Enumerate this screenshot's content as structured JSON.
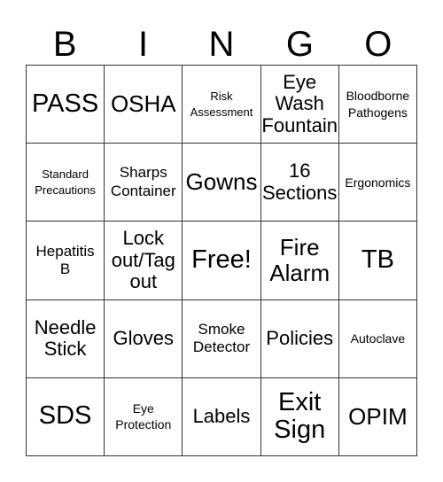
{
  "card": {
    "header": [
      "B",
      "I",
      "N",
      "G",
      "O"
    ],
    "rows": [
      [
        {
          "text": "PASS",
          "size": "s-xl"
        },
        {
          "text": "OSHA",
          "size": "s-l"
        },
        {
          "text": "Risk\nAssessment",
          "size": "s-xxs"
        },
        {
          "text": "Eye\nWash\nFountain",
          "size": "s-m"
        },
        {
          "text": "Bloodborne\nPathogens",
          "size": "s-xs"
        }
      ],
      [
        {
          "text": "Standard\nPrecautions",
          "size": "s-xxs"
        },
        {
          "text": "Sharps\nContainer",
          "size": "s-s"
        },
        {
          "text": "Gowns",
          "size": "s-l"
        },
        {
          "text": "16\nSections",
          "size": "s-m"
        },
        {
          "text": "Ergonomics",
          "size": "s-xs"
        }
      ],
      [
        {
          "text": "Hepatitis\nB",
          "size": "s-s"
        },
        {
          "text": "Lock\nout/Tag\nout",
          "size": "s-m"
        },
        {
          "text": "Free!",
          "size": "s-xl"
        },
        {
          "text": "Fire\nAlarm",
          "size": "s-l"
        },
        {
          "text": "TB",
          "size": "s-xl"
        }
      ],
      [
        {
          "text": "Needle\nStick",
          "size": "s-m"
        },
        {
          "text": "Gloves",
          "size": "s-m"
        },
        {
          "text": "Smoke\nDetector",
          "size": "s-s"
        },
        {
          "text": "Policies",
          "size": "s-m"
        },
        {
          "text": "Autoclave",
          "size": "s-xs"
        }
      ],
      [
        {
          "text": "SDS",
          "size": "s-xl"
        },
        {
          "text": "Eye\nProtection",
          "size": "s-xs"
        },
        {
          "text": "Labels",
          "size": "s-m"
        },
        {
          "text": "Exit\nSign",
          "size": "s-xl"
        },
        {
          "text": "OPIM",
          "size": "s-l"
        }
      ]
    ]
  }
}
